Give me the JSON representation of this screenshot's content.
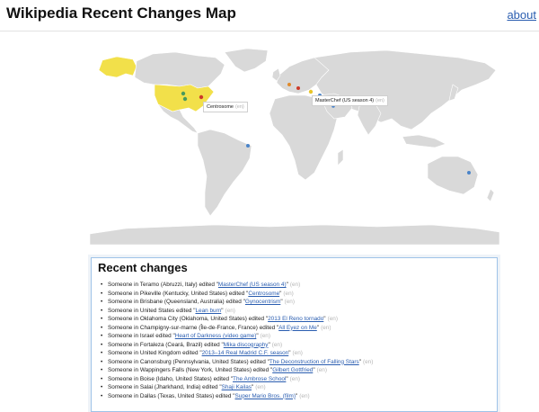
{
  "header": {
    "title": "Wikipedia Recent Changes Map",
    "about_label": "about"
  },
  "map": {
    "colors": {
      "ocean": "#ffffff",
      "land": "#d9d9d9",
      "land_stroke": "#ffffff",
      "highlight_land": "#f2e04a",
      "dot_green": "#4a9a5c",
      "dot_blue": "#4a84c9",
      "dot_orange": "#e08a2a",
      "dot_red": "#cc3a2a",
      "dot_yellow": "#e8c52a"
    },
    "tooltips": [
      {
        "title": "Centrosome",
        "lang": "(en)"
      },
      {
        "title": "MasterChef (US season 4)",
        "lang": "(en)"
      }
    ]
  },
  "recent": {
    "heading": "Recent changes",
    "items": [
      {
        "prefix": "Someone in Teramo (Abruzzi, Italy) edited \"",
        "title": "MasterChef (US season 4)",
        "suffix": "\"",
        "lang": "(en)"
      },
      {
        "prefix": "Someone in Pikeville (Kentucky, United States) edited \"",
        "title": "Centrosome",
        "suffix": "\"",
        "lang": "(en)"
      },
      {
        "prefix": "Someone in Brisbane (Queensland, Australia) edited \"",
        "title": "Gynocentrism",
        "suffix": "\"",
        "lang": "(en)"
      },
      {
        "prefix": "Someone in United States edited \"",
        "title": "Lean burn",
        "suffix": "\"",
        "lang": "(en)"
      },
      {
        "prefix": "Someone in Oklahoma City (Oklahoma, United States) edited \"",
        "title": "2013 El Reno tornado",
        "suffix": "\"",
        "lang": "(en)"
      },
      {
        "prefix": "Someone in Champigny-sur-marne (Île-de-France, France) edited \"",
        "title": "All Eyez on Me",
        "suffix": "\"",
        "lang": "(en)"
      },
      {
        "prefix": "Someone in Israel edited \"",
        "title": "Heart of Darkness (video game)",
        "suffix": "\"",
        "lang": "(en)"
      },
      {
        "prefix": "Someone in Fortaleza (Ceará, Brazil) edited \"",
        "title": "Mika discography",
        "suffix": "\"",
        "lang": "(en)"
      },
      {
        "prefix": "Someone in United Kingdom edited \"",
        "title": "2013–14 Real Madrid C.F. season",
        "suffix": "\"",
        "lang": "(en)"
      },
      {
        "prefix": "Someone in Canonsburg (Pennsylvania, United States) edited \"",
        "title": "The Deconstruction of Falling Stars",
        "suffix": "\"",
        "lang": "(en)"
      },
      {
        "prefix": "Someone in Wappingers Falls (New York, United States) edited \"",
        "title": "Gilbert Gottfried",
        "suffix": "\"",
        "lang": "(en)"
      },
      {
        "prefix": "Someone in Boise (Idaho, United States) edited \"",
        "title": "The Ambrose School",
        "suffix": "\"",
        "lang": "(en)"
      },
      {
        "prefix": "Someone in Salai (Jharkhand, India) edited \"",
        "title": "Shaji Kailas",
        "suffix": "\"",
        "lang": "(en)"
      },
      {
        "prefix": "Someone in Dallas (Texas, United States) edited \"",
        "title": "Super Mario Bros. (film)",
        "suffix": "\"",
        "lang": "(en)"
      }
    ]
  }
}
